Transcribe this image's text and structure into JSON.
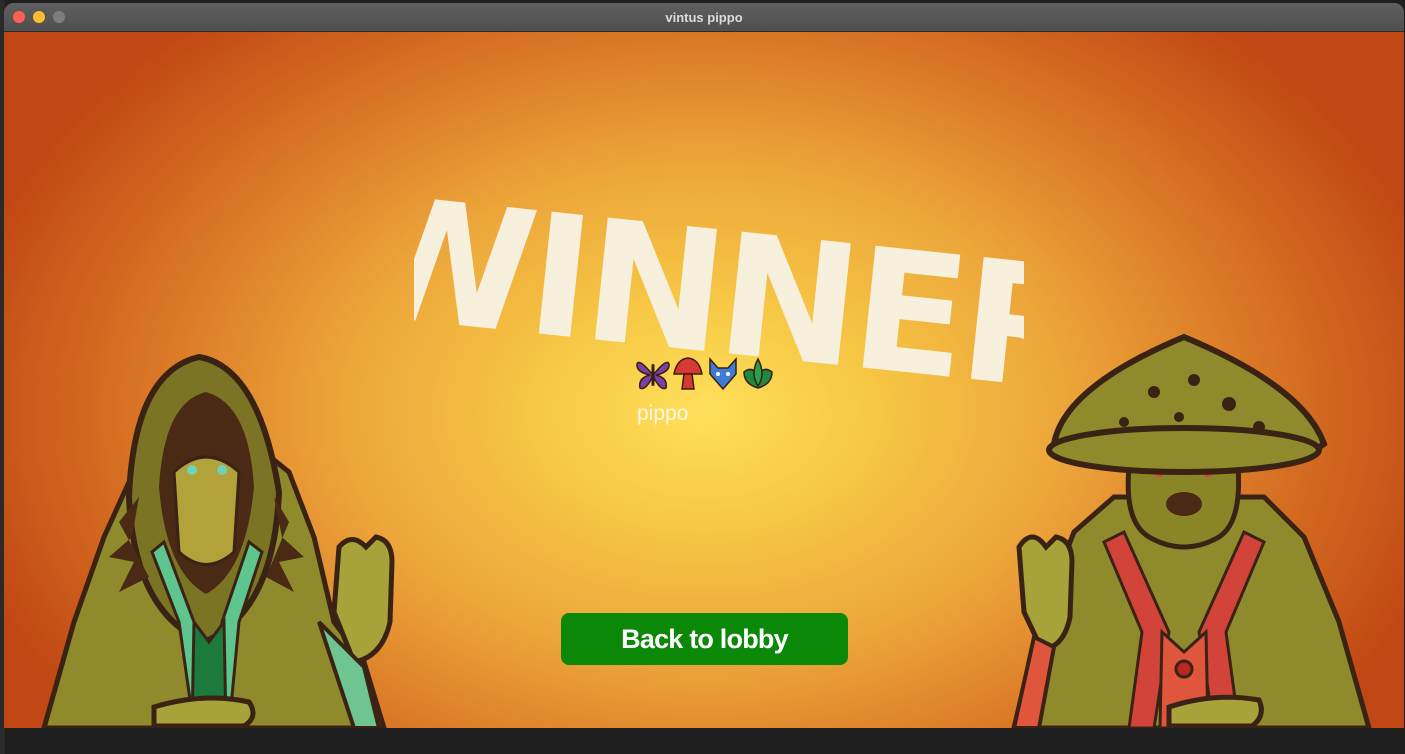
{
  "window": {
    "title": "vintus pippo"
  },
  "screen": {
    "heading": "WINNER",
    "winner": {
      "player_name": "pippo",
      "icons": [
        "butterfly-icon",
        "mushroom-icon",
        "fox-icon",
        "leaf-icon"
      ]
    },
    "back_button_label": "Back to lobby"
  },
  "colors": {
    "background_center": "#ffe05a",
    "background_edge": "#c14814",
    "heading": "#f6f0dc",
    "button": "#0b8808"
  }
}
